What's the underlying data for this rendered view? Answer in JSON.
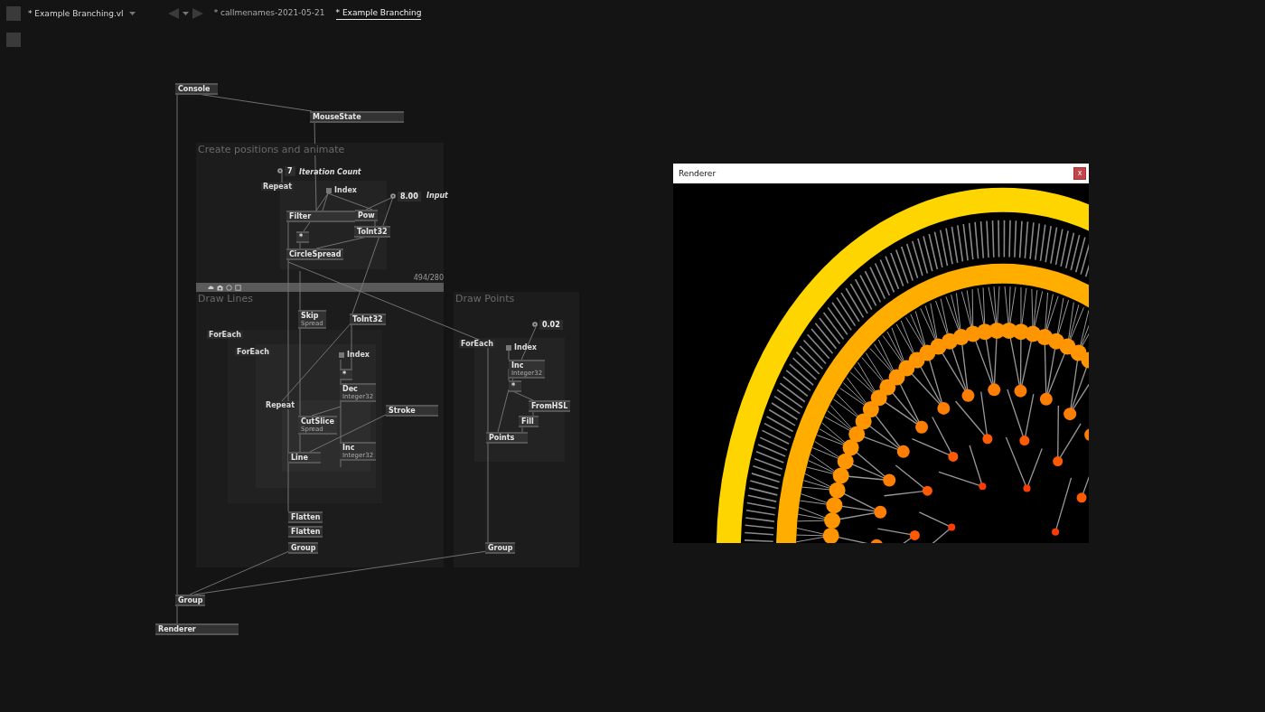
{
  "file_tab": {
    "label": "* Example Branching.vl"
  },
  "breadcrumbs": [
    {
      "label": "* callmenames-2021-05-21",
      "selected": false
    },
    {
      "label": "* Example Branching",
      "selected": true
    }
  ],
  "regions": [
    {
      "title": "Create positions and animate"
    },
    {
      "title": "Draw Lines"
    },
    {
      "title": "Draw Points"
    }
  ],
  "region_size": "494/280",
  "nodes": [
    {
      "kind": "node",
      "label": "Console"
    },
    {
      "kind": "node",
      "label": "MouseState"
    },
    {
      "kind": "iobox",
      "label": "7"
    },
    {
      "kind": "comment",
      "label": "Iteration Count"
    },
    {
      "kind": "label",
      "label": "Repeat"
    },
    {
      "kind": "index",
      "label": "Index"
    },
    {
      "kind": "iobox",
      "label": "8.00"
    },
    {
      "kind": "comment",
      "label": "Input"
    },
    {
      "kind": "node",
      "label": "Filter"
    },
    {
      "kind": "node",
      "label": "Pow"
    },
    {
      "kind": "node",
      "label": "*"
    },
    {
      "kind": "node",
      "label": "ToInt32"
    },
    {
      "kind": "node",
      "label": "CircleSpread"
    },
    {
      "kind": "node",
      "label": "Skip",
      "sub": "Spread"
    },
    {
      "kind": "node",
      "label": "ToInt32"
    },
    {
      "kind": "label",
      "label": "ForEach"
    },
    {
      "kind": "label",
      "label": "ForEach"
    },
    {
      "kind": "index",
      "label": "Index"
    },
    {
      "kind": "node",
      "label": "*"
    },
    {
      "kind": "node",
      "label": "Dec",
      "sub": "Integer32"
    },
    {
      "kind": "label",
      "label": "Repeat"
    },
    {
      "kind": "node",
      "label": "CutSlice",
      "sub": "Spread"
    },
    {
      "kind": "node",
      "label": "Stroke"
    },
    {
      "kind": "node",
      "label": "Line"
    },
    {
      "kind": "node",
      "label": "Inc",
      "sub": "Integer32"
    },
    {
      "kind": "node",
      "label": "Flatten"
    },
    {
      "kind": "node",
      "label": "Flatten"
    },
    {
      "kind": "node",
      "label": "Group"
    },
    {
      "kind": "iobox",
      "label": "0.02"
    },
    {
      "kind": "label",
      "label": "ForEach"
    },
    {
      "kind": "index",
      "label": "Index"
    },
    {
      "kind": "node",
      "label": "Inc",
      "sub": "Integer32"
    },
    {
      "kind": "node",
      "label": "*"
    },
    {
      "kind": "node",
      "label": "FromHSL"
    },
    {
      "kind": "node",
      "label": "Fill"
    },
    {
      "kind": "node",
      "label": "Points"
    },
    {
      "kind": "node",
      "label": "Group"
    },
    {
      "kind": "node",
      "label": "Group"
    },
    {
      "kind": "node",
      "label": "Renderer"
    }
  ],
  "renderer": {
    "title": "Renderer",
    "close": "x"
  }
}
